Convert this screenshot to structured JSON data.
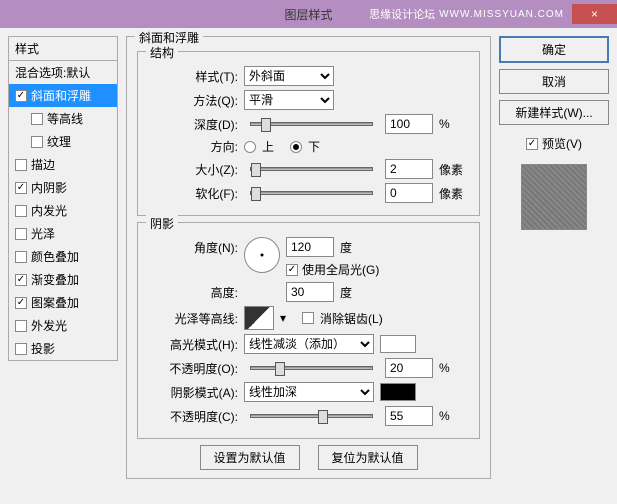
{
  "titlebar": {
    "title": "图层样式",
    "forum": "思缘设计论坛",
    "url": "WWW.MISSYUAN.COM",
    "close": "×"
  },
  "left": {
    "header": "样式",
    "blend_opts": "混合选项:默认",
    "bevel": "斜面和浮雕",
    "contour": "等高线",
    "texture": "纹理",
    "stroke": "描边",
    "inner_shadow": "内阴影",
    "inner_glow": "内发光",
    "satin": "光泽",
    "color_overlay": "颜色叠加",
    "gradient_overlay": "渐变叠加",
    "pattern_overlay": "图案叠加",
    "outer_glow": "外发光",
    "drop_shadow": "投影"
  },
  "center": {
    "group_title": "斜面和浮雕",
    "structure": {
      "legend": "结构",
      "style_label": "样式(T):",
      "style_value": "外斜面",
      "technique_label": "方法(Q):",
      "technique_value": "平滑",
      "depth_label": "深度(D):",
      "depth_value": "100",
      "percent": "%",
      "direction_label": "方向:",
      "up": "上",
      "down": "下",
      "size_label": "大小(Z):",
      "size_value": "2",
      "px": "像素",
      "soften_label": "软化(F):",
      "soften_value": "0"
    },
    "shading": {
      "legend": "阴影",
      "angle_label": "角度(N):",
      "angle_value": "120",
      "deg": "度",
      "global_light": "使用全局光(G)",
      "altitude_label": "高度:",
      "altitude_value": "30",
      "gloss_label": "光泽等高线:",
      "antialias": "消除锯齿(L)",
      "highlight_mode_label": "高光模式(H):",
      "highlight_mode_value": "线性减淡（添加）",
      "highlight_opacity_label": "不透明度(O):",
      "highlight_opacity_value": "20",
      "shadow_mode_label": "阴影模式(A):",
      "shadow_mode_value": "线性加深",
      "shadow_opacity_label": "不透明度(C):",
      "shadow_opacity_value": "55"
    },
    "buttons": {
      "make_default": "设置为默认值",
      "reset_default": "复位为默认值"
    }
  },
  "right": {
    "ok": "确定",
    "cancel": "取消",
    "new_style": "新建样式(W)...",
    "preview": "预览(V)"
  },
  "colors": {
    "highlight_swatch": "#ffffff",
    "shadow_swatch": "#000000"
  }
}
